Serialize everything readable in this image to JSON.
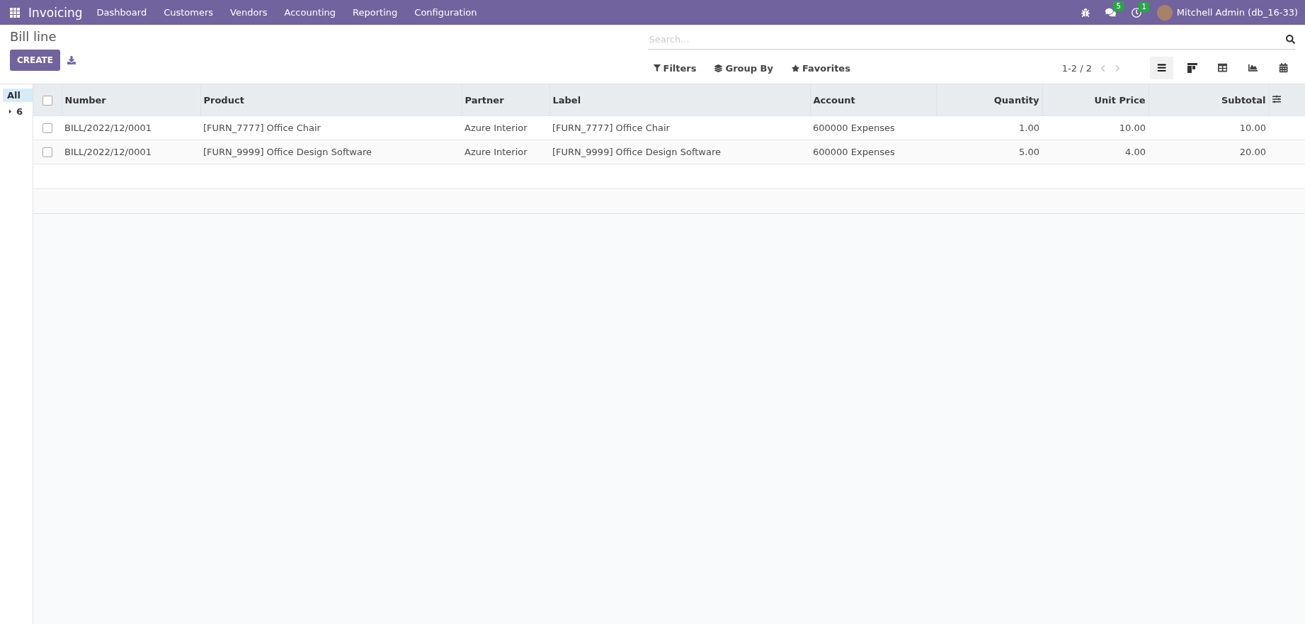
{
  "navbar": {
    "app_name": "Invoicing",
    "menu": [
      "Dashboard",
      "Customers",
      "Vendors",
      "Accounting",
      "Reporting",
      "Configuration"
    ],
    "messages_count": "5",
    "activities_count": "1",
    "user": "Mitchell Admin (db_16-33)"
  },
  "breadcrumb": "Bill line",
  "create_button": "CREATE",
  "search": {
    "placeholder": "Search..."
  },
  "search_options": [
    {
      "kind": "filter",
      "label": "Filters"
    },
    {
      "kind": "group",
      "label": "Group By"
    },
    {
      "kind": "favorite",
      "label": "Favorites"
    }
  ],
  "pager": "1-2 / 2",
  "views": [
    {
      "kind": "list",
      "selected": true
    },
    {
      "kind": "kanban",
      "selected": false
    },
    {
      "kind": "pivot",
      "selected": false
    },
    {
      "kind": "graph",
      "selected": false
    },
    {
      "kind": "calendar",
      "selected": false
    }
  ],
  "sidebar": {
    "items": [
      {
        "label": "All",
        "selected": true
      },
      {
        "label": "6",
        "selected": false,
        "expanded": false
      }
    ]
  },
  "table": {
    "select_all": {
      "checked": false
    },
    "columns": [
      {
        "label": "Number",
        "kind": "text"
      },
      {
        "label": "Product",
        "kind": "text"
      },
      {
        "label": "Partner",
        "kind": "text"
      },
      {
        "label": "Label",
        "kind": "text"
      },
      {
        "label": "Account",
        "kind": "text"
      },
      {
        "label": "Quantity",
        "kind": "number"
      },
      {
        "label": "Unit Price",
        "kind": "number"
      },
      {
        "label": "Subtotal",
        "kind": "number"
      }
    ],
    "rows": [
      {
        "checked": false,
        "cells": [
          "BILL/2022/12/0001",
          "[FURN_7777] Office Chair",
          "Azure Interior",
          "[FURN_7777] Office Chair",
          "600000 Expenses",
          "1.00",
          "10.00",
          "10.00"
        ]
      },
      {
        "checked": false,
        "cells": [
          "BILL/2022/12/0001",
          "[FURN_9999] Office Design Software",
          "Azure Interior",
          "[FURN_9999] Office Design Software",
          "600000 Expenses",
          "5.00",
          "4.00",
          "20.00"
        ]
      }
    ]
  }
}
